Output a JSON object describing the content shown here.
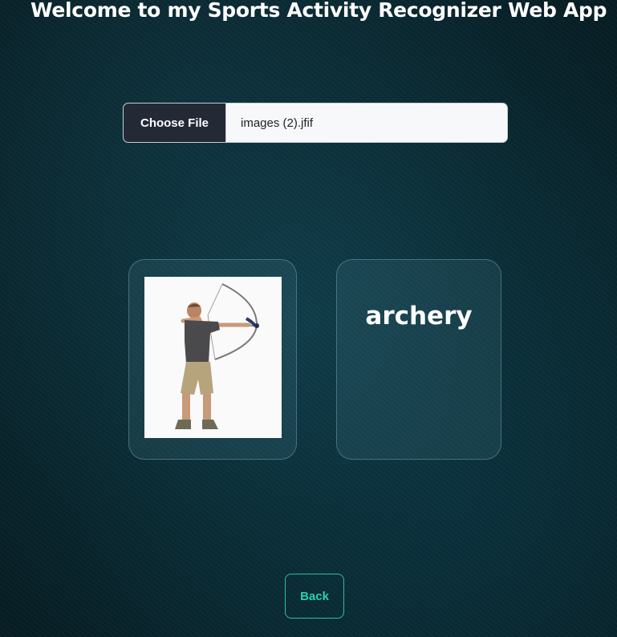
{
  "page": {
    "title": "Welcome to my Sports Activity Recognizer Web App"
  },
  "upload": {
    "button_label": "Choose File",
    "file_name": "images (2).jfif"
  },
  "result": {
    "prediction": "archery"
  },
  "nav": {
    "back_label": "Back"
  },
  "colors": {
    "background": "#082a33",
    "accent": "#2bd0a8",
    "choose_button": "#232a36"
  }
}
